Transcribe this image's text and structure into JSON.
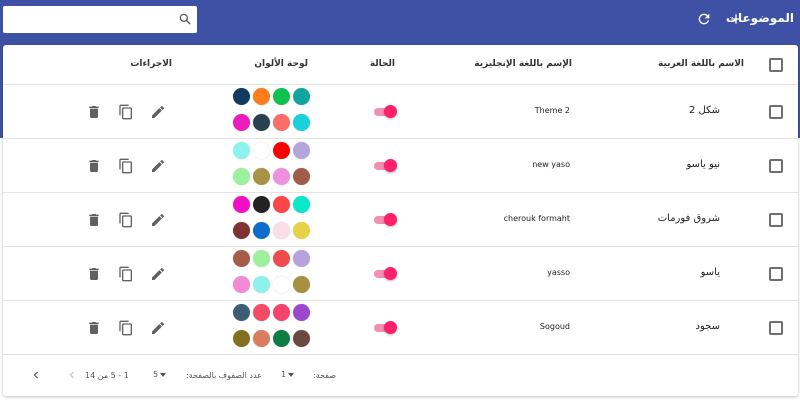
{
  "app": {
    "title": "الموضوعات",
    "search": {
      "value": "",
      "placeholder": ""
    },
    "icons": {
      "add": "add-icon",
      "refresh": "refresh-icon",
      "search": "search-icon"
    },
    "colors": {
      "header_bg": "#3f51a5",
      "toggle_on": "#ff1f6b"
    }
  },
  "table": {
    "headers": {
      "name_ar": "الاسم باللغة العربية",
      "name_en": "الإسم باللغة الإنجليزية",
      "status": "الحالة",
      "palette": "لوحة الألوان",
      "actions": "الاجراءات"
    },
    "rows": [
      {
        "name_ar": "شكل 2",
        "name_en": "Theme 2",
        "status": true,
        "colors": [
          "#0e3b5f",
          "#fb7d1e",
          "#0fc24d",
          "#10a59e",
          "#ec1bbd",
          "#274150",
          "#fa6e67",
          "#19d1dc"
        ]
      },
      {
        "name_ar": "نيو ياسو",
        "name_en": "new yaso",
        "status": true,
        "colors": [
          "#8ff3ed",
          "#ffffff",
          "#f60202",
          "#b5a5de",
          "#9cf19d",
          "#a79246",
          "#f090e0",
          "#a15d48"
        ]
      },
      {
        "name_ar": "شروق فورمات",
        "name_en": "cherouk formaht",
        "status": true,
        "colors": [
          "#f30dc3",
          "#232323",
          "#fb4546",
          "#09e8c9",
          "#7f3231",
          "#0c6dcd",
          "#fbdfe8",
          "#e7d247"
        ]
      },
      {
        "name_ar": "ياسو",
        "name_en": "yasso",
        "status": true,
        "colors": [
          "#a55d49",
          "#9ef09d",
          "#f04b4c",
          "#b6a3de",
          "#f28ad8",
          "#8ff2ea",
          "#ffffff",
          "#a79042"
        ]
      },
      {
        "name_ar": "سجود",
        "name_en": "Sogoud",
        "status": true,
        "colors": [
          "#3c5d74",
          "#f34a66",
          "#f5436c",
          "#9d47cc",
          "#836f1f",
          "#d97d61",
          "#0c7e44",
          "#6a4940"
        ]
      }
    ]
  },
  "footer": {
    "page_label": "صفحة:",
    "page_value": "1",
    "rows_label": "عدد الصفوف بالصفحة:",
    "rows_value": "5",
    "range": "1 - 5 من 14"
  }
}
